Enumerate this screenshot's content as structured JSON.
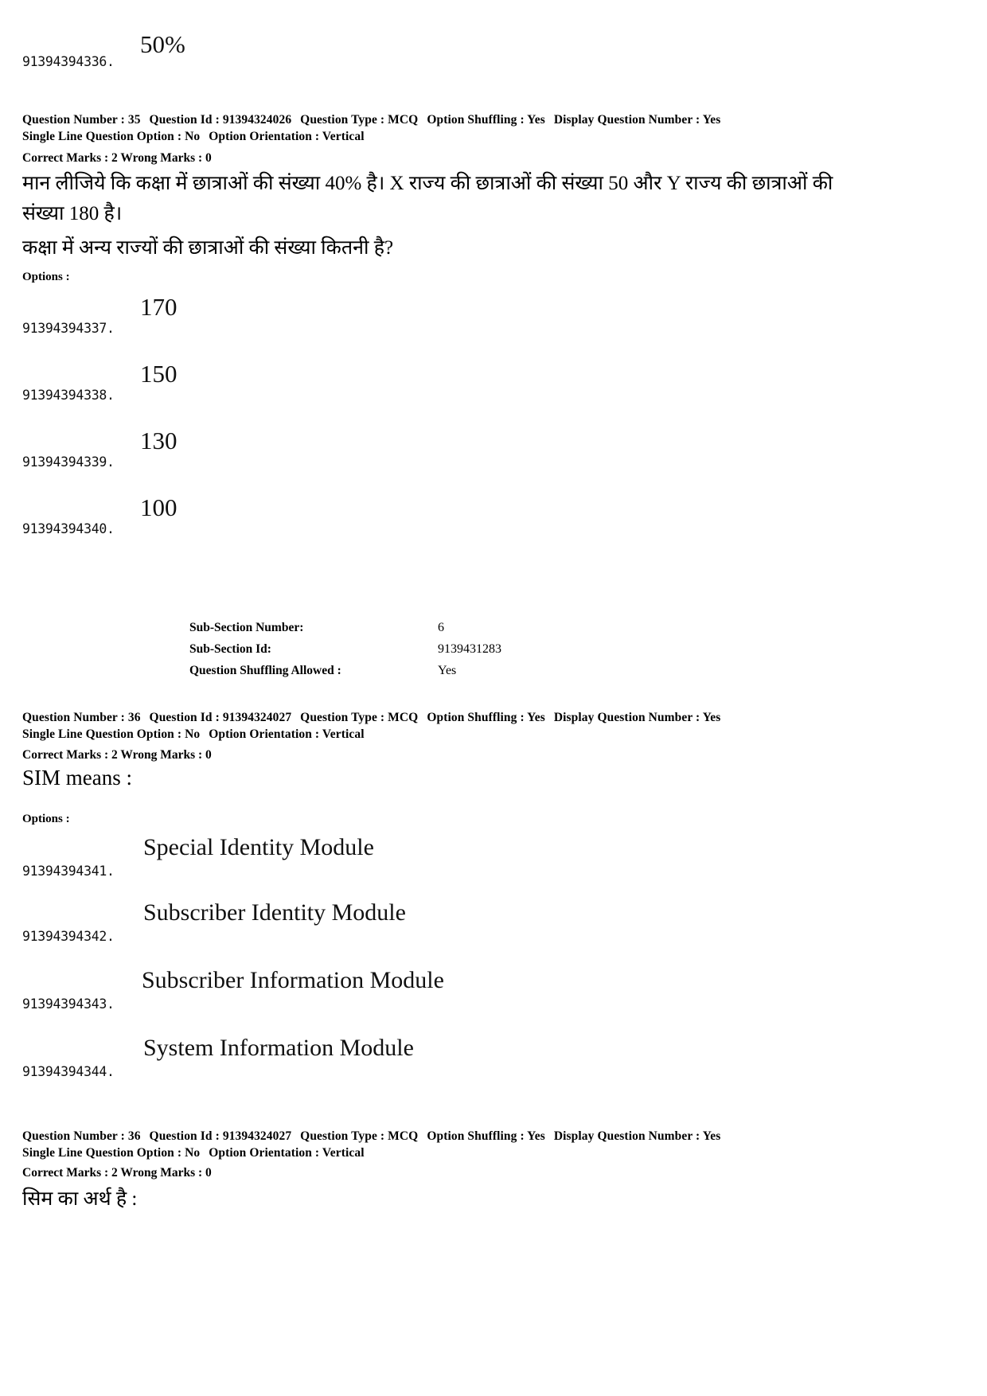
{
  "page": {
    "top_option": {
      "id": "91394394336.",
      "value": "50%"
    }
  },
  "questions": [
    {
      "meta": {
        "question_number_label": "Question Number :",
        "question_number": "35",
        "question_id_label": "Question Id :",
        "question_id": "91394324026",
        "question_type_label": "Question Type :",
        "question_type": "MCQ",
        "option_shuffling_label": "Option Shuffling :",
        "option_shuffling": "Yes",
        "display_question_number_label": "Display Question Number :",
        "display_question_number": "Yes",
        "single_line_question_option_label": "Single Line Question Option :",
        "single_line_question_option": "No",
        "option_orientation_label": "Option Orientation :",
        "option_orientation": "Vertical",
        "correct_marks_label": "Correct Marks :",
        "correct_marks": "2",
        "wrong_marks_label": "Wrong Marks :",
        "wrong_marks": "0"
      },
      "body_line1": "मान लीजिये कि कक्षा में छात्राओं की संख्या 40% है। X राज्य की छात्राओं की संख्या 50 और Y राज्य की छात्राओं की",
      "body_line2": "संख्या 180 है।",
      "body_line3": "कक्षा में अन्य राज्यों की छात्राओं की संख्या कितनी है?",
      "options_label": "Options :",
      "options": [
        {
          "id": "91394394337.",
          "value": "170"
        },
        {
          "id": "91394394338.",
          "value": "150"
        },
        {
          "id": "91394394339.",
          "value": "130"
        },
        {
          "id": "91394394340.",
          "value": "100"
        }
      ]
    },
    {
      "meta": {
        "question_number_label": "Question Number :",
        "question_number": "36",
        "question_id_label": "Question Id :",
        "question_id": "91394324027",
        "question_type_label": "Question Type :",
        "question_type": "MCQ",
        "option_shuffling_label": "Option Shuffling :",
        "option_shuffling": "Yes",
        "display_question_number_label": "Display Question Number :",
        "display_question_number": "Yes",
        "single_line_question_option_label": "Single Line Question Option :",
        "single_line_question_option": "No",
        "option_orientation_label": "Option Orientation :",
        "option_orientation": "Vertical",
        "correct_marks_label": "Correct Marks :",
        "correct_marks": "2",
        "wrong_marks_label": "Wrong Marks :",
        "wrong_marks": "0"
      },
      "body_line1": "SIM means :",
      "options_label": "Options :",
      "options": [
        {
          "id": "91394394341.",
          "value": "Special Identity Module"
        },
        {
          "id": "91394394342.",
          "value": "Subscriber Identity Module"
        },
        {
          "id": "91394394343.",
          "value": "Subscriber  Information  Module"
        },
        {
          "id": "91394394344.",
          "value": "System Information Module"
        }
      ]
    },
    {
      "meta": {
        "question_number_label": "Question Number :",
        "question_number": "36",
        "question_id_label": "Question Id :",
        "question_id": "91394324027",
        "question_type_label": "Question Type :",
        "question_type": "MCQ",
        "option_shuffling_label": "Option Shuffling :",
        "option_shuffling": "Yes",
        "display_question_number_label": "Display Question Number :",
        "display_question_number": "Yes",
        "single_line_question_option_label": "Single Line Question Option :",
        "single_line_question_option": "No",
        "option_orientation_label": "Option Orientation :",
        "option_orientation": "Vertical",
        "correct_marks_label": "Correct Marks :",
        "correct_marks": "2",
        "wrong_marks_label": "Wrong Marks :",
        "wrong_marks": "0"
      },
      "body_line1": "सिम का अर्थ है :"
    }
  ],
  "sub_section": {
    "number_label": "Sub-Section Number:",
    "number": "6",
    "id_label": "Sub-Section Id:",
    "id": "9139431283",
    "shuffling_label": "Question Shuffling Allowed :",
    "shuffling": "Yes"
  }
}
